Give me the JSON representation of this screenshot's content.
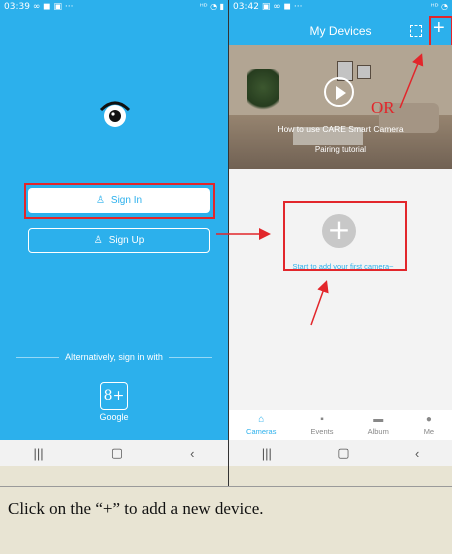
{
  "left_phone": {
    "statusbar": {
      "time": "03:39"
    },
    "buttons": {
      "sign_in": "Sign In",
      "sign_up": "Sign Up"
    },
    "alternative_text": "Alternatively, sign in with",
    "google_label": "Google",
    "google_icon_text": "8+"
  },
  "right_phone": {
    "statusbar": {
      "time": "03:42"
    },
    "header": {
      "title": "My Devices"
    },
    "banner": {
      "title": "How to use CARE Smart Camera",
      "subtitle": "Pairing tutorial"
    },
    "or_text": "OR",
    "add_hint": "Start to add your first camera~",
    "tabs": [
      {
        "label": "Cameras",
        "icon": "home-icon"
      },
      {
        "label": "Events",
        "icon": "chat-icon"
      },
      {
        "label": "Album",
        "icon": "album-icon"
      },
      {
        "label": "Me",
        "icon": "person-icon"
      }
    ]
  },
  "caption": "Click on the “+” to add a new device.",
  "colors": {
    "app_blue": "#2cb0ec",
    "highlight_red": "#e2262b"
  }
}
